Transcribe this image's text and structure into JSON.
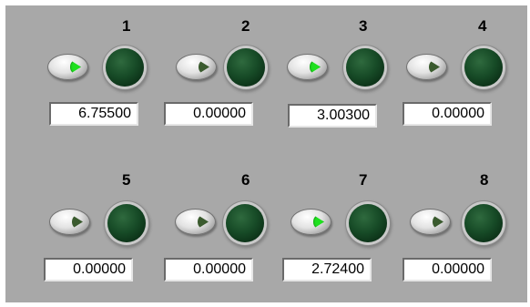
{
  "channels": [
    {
      "number": "1",
      "value": "6.75500",
      "switch_on": true
    },
    {
      "number": "2",
      "value": "0.00000",
      "switch_on": false
    },
    {
      "number": "3",
      "value": "3.00300",
      "switch_on": true
    },
    {
      "number": "4",
      "value": "0.00000",
      "switch_on": false
    },
    {
      "number": "5",
      "value": "0.00000",
      "switch_on": false
    },
    {
      "number": "6",
      "value": "0.00000",
      "switch_on": false
    },
    {
      "number": "7",
      "value": "2.72400",
      "switch_on": true
    },
    {
      "number": "8",
      "value": "0.00000",
      "switch_on": false
    }
  ],
  "colors": {
    "panel_bg": "#a8a8a8",
    "switch_on_indicator": "#1fe01f",
    "switch_off_indicator": "#3a5a2e",
    "led_off": "#174b27"
  },
  "icons": {
    "switch": "toggle-switch-icon",
    "led": "led-indicator-icon"
  }
}
